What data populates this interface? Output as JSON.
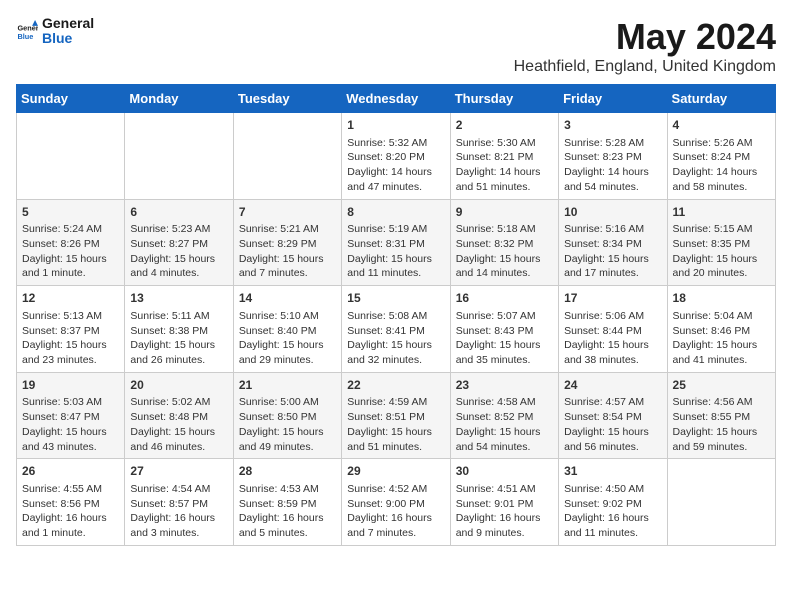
{
  "logo": {
    "general": "General",
    "blue": "Blue"
  },
  "title": "May 2024",
  "subtitle": "Heathfield, England, United Kingdom",
  "days_of_week": [
    "Sunday",
    "Monday",
    "Tuesday",
    "Wednesday",
    "Thursday",
    "Friday",
    "Saturday"
  ],
  "weeks": [
    [
      {
        "num": "",
        "lines": []
      },
      {
        "num": "",
        "lines": []
      },
      {
        "num": "",
        "lines": []
      },
      {
        "num": "1",
        "lines": [
          "Sunrise: 5:32 AM",
          "Sunset: 8:20 PM",
          "Daylight: 14 hours",
          "and 47 minutes."
        ]
      },
      {
        "num": "2",
        "lines": [
          "Sunrise: 5:30 AM",
          "Sunset: 8:21 PM",
          "Daylight: 14 hours",
          "and 51 minutes."
        ]
      },
      {
        "num": "3",
        "lines": [
          "Sunrise: 5:28 AM",
          "Sunset: 8:23 PM",
          "Daylight: 14 hours",
          "and 54 minutes."
        ]
      },
      {
        "num": "4",
        "lines": [
          "Sunrise: 5:26 AM",
          "Sunset: 8:24 PM",
          "Daylight: 14 hours",
          "and 58 minutes."
        ]
      }
    ],
    [
      {
        "num": "5",
        "lines": [
          "Sunrise: 5:24 AM",
          "Sunset: 8:26 PM",
          "Daylight: 15 hours",
          "and 1 minute."
        ]
      },
      {
        "num": "6",
        "lines": [
          "Sunrise: 5:23 AM",
          "Sunset: 8:27 PM",
          "Daylight: 15 hours",
          "and 4 minutes."
        ]
      },
      {
        "num": "7",
        "lines": [
          "Sunrise: 5:21 AM",
          "Sunset: 8:29 PM",
          "Daylight: 15 hours",
          "and 7 minutes."
        ]
      },
      {
        "num": "8",
        "lines": [
          "Sunrise: 5:19 AM",
          "Sunset: 8:31 PM",
          "Daylight: 15 hours",
          "and 11 minutes."
        ]
      },
      {
        "num": "9",
        "lines": [
          "Sunrise: 5:18 AM",
          "Sunset: 8:32 PM",
          "Daylight: 15 hours",
          "and 14 minutes."
        ]
      },
      {
        "num": "10",
        "lines": [
          "Sunrise: 5:16 AM",
          "Sunset: 8:34 PM",
          "Daylight: 15 hours",
          "and 17 minutes."
        ]
      },
      {
        "num": "11",
        "lines": [
          "Sunrise: 5:15 AM",
          "Sunset: 8:35 PM",
          "Daylight: 15 hours",
          "and 20 minutes."
        ]
      }
    ],
    [
      {
        "num": "12",
        "lines": [
          "Sunrise: 5:13 AM",
          "Sunset: 8:37 PM",
          "Daylight: 15 hours",
          "and 23 minutes."
        ]
      },
      {
        "num": "13",
        "lines": [
          "Sunrise: 5:11 AM",
          "Sunset: 8:38 PM",
          "Daylight: 15 hours",
          "and 26 minutes."
        ]
      },
      {
        "num": "14",
        "lines": [
          "Sunrise: 5:10 AM",
          "Sunset: 8:40 PM",
          "Daylight: 15 hours",
          "and 29 minutes."
        ]
      },
      {
        "num": "15",
        "lines": [
          "Sunrise: 5:08 AM",
          "Sunset: 8:41 PM",
          "Daylight: 15 hours",
          "and 32 minutes."
        ]
      },
      {
        "num": "16",
        "lines": [
          "Sunrise: 5:07 AM",
          "Sunset: 8:43 PM",
          "Daylight: 15 hours",
          "and 35 minutes."
        ]
      },
      {
        "num": "17",
        "lines": [
          "Sunrise: 5:06 AM",
          "Sunset: 8:44 PM",
          "Daylight: 15 hours",
          "and 38 minutes."
        ]
      },
      {
        "num": "18",
        "lines": [
          "Sunrise: 5:04 AM",
          "Sunset: 8:46 PM",
          "Daylight: 15 hours",
          "and 41 minutes."
        ]
      }
    ],
    [
      {
        "num": "19",
        "lines": [
          "Sunrise: 5:03 AM",
          "Sunset: 8:47 PM",
          "Daylight: 15 hours",
          "and 43 minutes."
        ]
      },
      {
        "num": "20",
        "lines": [
          "Sunrise: 5:02 AM",
          "Sunset: 8:48 PM",
          "Daylight: 15 hours",
          "and 46 minutes."
        ]
      },
      {
        "num": "21",
        "lines": [
          "Sunrise: 5:00 AM",
          "Sunset: 8:50 PM",
          "Daylight: 15 hours",
          "and 49 minutes."
        ]
      },
      {
        "num": "22",
        "lines": [
          "Sunrise: 4:59 AM",
          "Sunset: 8:51 PM",
          "Daylight: 15 hours",
          "and 51 minutes."
        ]
      },
      {
        "num": "23",
        "lines": [
          "Sunrise: 4:58 AM",
          "Sunset: 8:52 PM",
          "Daylight: 15 hours",
          "and 54 minutes."
        ]
      },
      {
        "num": "24",
        "lines": [
          "Sunrise: 4:57 AM",
          "Sunset: 8:54 PM",
          "Daylight: 15 hours",
          "and 56 minutes."
        ]
      },
      {
        "num": "25",
        "lines": [
          "Sunrise: 4:56 AM",
          "Sunset: 8:55 PM",
          "Daylight: 15 hours",
          "and 59 minutes."
        ]
      }
    ],
    [
      {
        "num": "26",
        "lines": [
          "Sunrise: 4:55 AM",
          "Sunset: 8:56 PM",
          "Daylight: 16 hours",
          "and 1 minute."
        ]
      },
      {
        "num": "27",
        "lines": [
          "Sunrise: 4:54 AM",
          "Sunset: 8:57 PM",
          "Daylight: 16 hours",
          "and 3 minutes."
        ]
      },
      {
        "num": "28",
        "lines": [
          "Sunrise: 4:53 AM",
          "Sunset: 8:59 PM",
          "Daylight: 16 hours",
          "and 5 minutes."
        ]
      },
      {
        "num": "29",
        "lines": [
          "Sunrise: 4:52 AM",
          "Sunset: 9:00 PM",
          "Daylight: 16 hours",
          "and 7 minutes."
        ]
      },
      {
        "num": "30",
        "lines": [
          "Sunrise: 4:51 AM",
          "Sunset: 9:01 PM",
          "Daylight: 16 hours",
          "and 9 minutes."
        ]
      },
      {
        "num": "31",
        "lines": [
          "Sunrise: 4:50 AM",
          "Sunset: 9:02 PM",
          "Daylight: 16 hours",
          "and 11 minutes."
        ]
      },
      {
        "num": "",
        "lines": []
      }
    ]
  ]
}
